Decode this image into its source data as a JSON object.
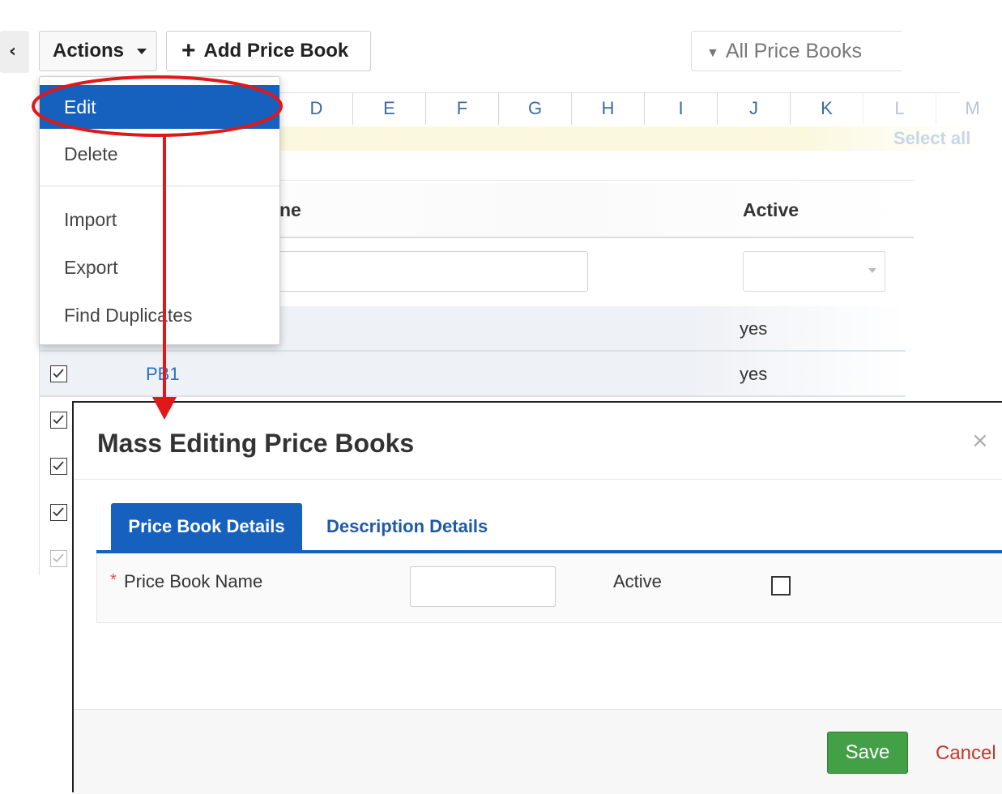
{
  "toolbar": {
    "back_glyph": "‹",
    "actions_label": "Actions",
    "add_label": "Add Price Book",
    "filter_label": "All Price Books"
  },
  "alphabet": [
    "D",
    "E",
    "F",
    "G",
    "H",
    "I",
    "J",
    "K",
    "L",
    "M"
  ],
  "select_all_label": "Select all",
  "columns": {
    "name_header": "ne",
    "active_header": "Active"
  },
  "rows": [
    {
      "name": "",
      "active": "yes",
      "checked": true
    },
    {
      "name": "PB1",
      "active": "yes",
      "checked": true
    },
    {
      "name": "",
      "active": "",
      "checked": true
    },
    {
      "name": "",
      "active": "",
      "checked": true
    },
    {
      "name": "",
      "active": "",
      "checked": true
    },
    {
      "name": "",
      "active": "",
      "checked": true
    }
  ],
  "actions_menu": {
    "items": [
      "Edit",
      "Delete",
      "Import",
      "Export",
      "Find Duplicates"
    ],
    "selected": "Edit"
  },
  "modal": {
    "title": "Mass Editing Price Books",
    "close_glyph": "×",
    "tabs": [
      "Price Book Details",
      "Description Details"
    ],
    "active_tab": "Price Book Details",
    "fields": {
      "required_marker": "*",
      "name_label": "Price Book Name",
      "name_value": "",
      "active_label": "Active",
      "active_checked": false
    },
    "save_label": "Save",
    "cancel_label": "Cancel"
  },
  "colors": {
    "primary": "#1661be",
    "link": "#2a6fc0",
    "save": "#43a047",
    "cancel": "#c0392b",
    "annotation": "#e01818",
    "required": "#d9534f"
  },
  "icons": {
    "back": "chevron-left-icon",
    "actions_caret": "caret-down-icon",
    "add": "plus-icon",
    "filter": "funnel-icon",
    "close": "close-icon",
    "row_check": "checkbox-checked-icon"
  }
}
